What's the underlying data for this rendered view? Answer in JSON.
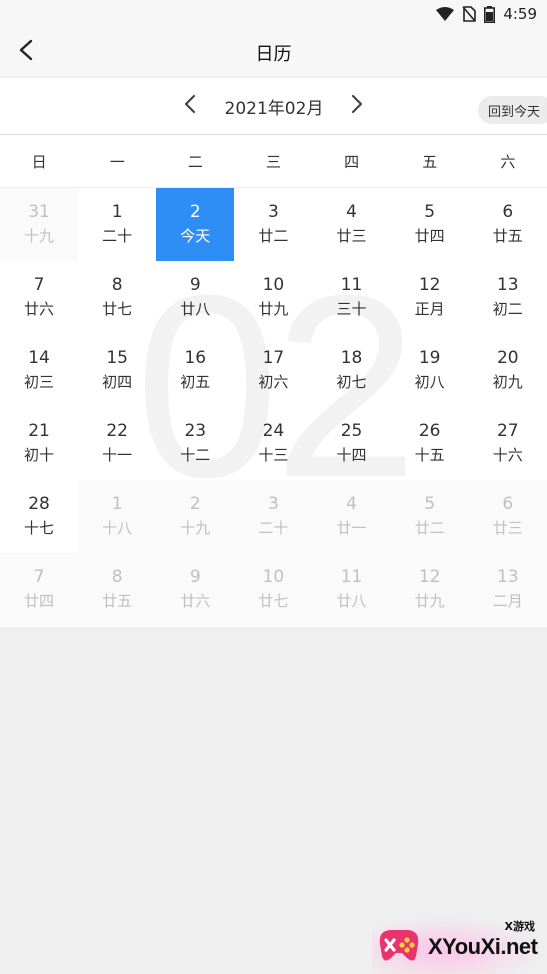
{
  "status": {
    "time": "4:59"
  },
  "nav": {
    "title": "日历"
  },
  "month": {
    "label": "2021年02月",
    "today_button": "回到今天",
    "watermark": "02"
  },
  "weekdays": [
    "日",
    "一",
    "二",
    "三",
    "四",
    "五",
    "六"
  ],
  "days": [
    {
      "num": "31",
      "lunar": "十九",
      "state": "other"
    },
    {
      "num": "1",
      "lunar": "二十",
      "state": "current"
    },
    {
      "num": "2",
      "lunar": "今天",
      "state": "selected"
    },
    {
      "num": "3",
      "lunar": "廿二",
      "state": "current"
    },
    {
      "num": "4",
      "lunar": "廿三",
      "state": "current"
    },
    {
      "num": "5",
      "lunar": "廿四",
      "state": "current"
    },
    {
      "num": "6",
      "lunar": "廿五",
      "state": "current"
    },
    {
      "num": "7",
      "lunar": "廿六",
      "state": "current"
    },
    {
      "num": "8",
      "lunar": "廿七",
      "state": "current"
    },
    {
      "num": "9",
      "lunar": "廿八",
      "state": "current"
    },
    {
      "num": "10",
      "lunar": "廿九",
      "state": "current"
    },
    {
      "num": "11",
      "lunar": "三十",
      "state": "current"
    },
    {
      "num": "12",
      "lunar": "正月",
      "state": "current"
    },
    {
      "num": "13",
      "lunar": "初二",
      "state": "current"
    },
    {
      "num": "14",
      "lunar": "初三",
      "state": "current"
    },
    {
      "num": "15",
      "lunar": "初四",
      "state": "current"
    },
    {
      "num": "16",
      "lunar": "初五",
      "state": "current"
    },
    {
      "num": "17",
      "lunar": "初六",
      "state": "current"
    },
    {
      "num": "18",
      "lunar": "初七",
      "state": "current"
    },
    {
      "num": "19",
      "lunar": "初八",
      "state": "current"
    },
    {
      "num": "20",
      "lunar": "初九",
      "state": "current"
    },
    {
      "num": "21",
      "lunar": "初十",
      "state": "current"
    },
    {
      "num": "22",
      "lunar": "十一",
      "state": "current"
    },
    {
      "num": "23",
      "lunar": "十二",
      "state": "current"
    },
    {
      "num": "24",
      "lunar": "十三",
      "state": "current"
    },
    {
      "num": "25",
      "lunar": "十四",
      "state": "current"
    },
    {
      "num": "26",
      "lunar": "十五",
      "state": "current"
    },
    {
      "num": "27",
      "lunar": "十六",
      "state": "current"
    },
    {
      "num": "28",
      "lunar": "十七",
      "state": "current"
    },
    {
      "num": "1",
      "lunar": "十八",
      "state": "other"
    },
    {
      "num": "2",
      "lunar": "十九",
      "state": "other"
    },
    {
      "num": "3",
      "lunar": "二十",
      "state": "other"
    },
    {
      "num": "4",
      "lunar": "廿一",
      "state": "other"
    },
    {
      "num": "5",
      "lunar": "廿二",
      "state": "other"
    },
    {
      "num": "6",
      "lunar": "廿三",
      "state": "other"
    },
    {
      "num": "7",
      "lunar": "廿四",
      "state": "other"
    },
    {
      "num": "8",
      "lunar": "廿五",
      "state": "other"
    },
    {
      "num": "9",
      "lunar": "廿六",
      "state": "other"
    },
    {
      "num": "10",
      "lunar": "廿七",
      "state": "other"
    },
    {
      "num": "11",
      "lunar": "廿八",
      "state": "other"
    },
    {
      "num": "12",
      "lunar": "廿九",
      "state": "other"
    },
    {
      "num": "13",
      "lunar": "二月",
      "state": "other"
    }
  ],
  "colors": {
    "selected": "#2f8ef5",
    "muted_text": "#c0c0c0"
  },
  "logo": {
    "small_text": "X游戏",
    "text": "XYouXi.net"
  }
}
